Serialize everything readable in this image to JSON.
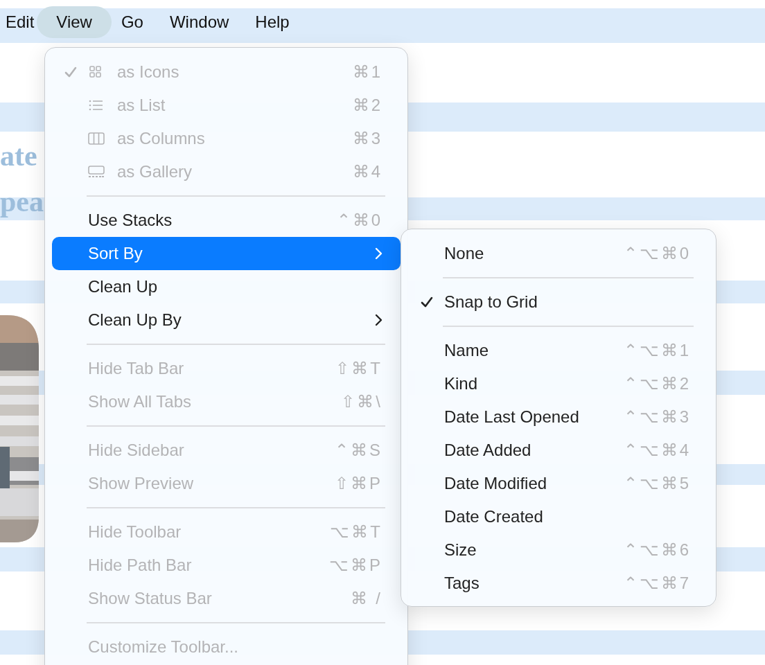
{
  "menu_bar": [
    {
      "label": "Edit",
      "selected": false
    },
    {
      "label": "View",
      "selected": true
    },
    {
      "label": "Go",
      "selected": false
    },
    {
      "label": "Window",
      "selected": false
    },
    {
      "label": "Help",
      "selected": false
    }
  ],
  "background_text": [
    "ate",
    "pea"
  ],
  "view_menu": {
    "items": [
      {
        "kind": "view",
        "label": "as Icons",
        "shortcut": "⌘1",
        "checked": true,
        "disabled": true,
        "selected": false
      },
      {
        "kind": "view",
        "label": "as List",
        "shortcut": "⌘2",
        "checked": false,
        "disabled": true,
        "selected": false
      },
      {
        "kind": "view",
        "label": "as Columns",
        "shortcut": "⌘3",
        "checked": false,
        "disabled": true,
        "selected": false
      },
      {
        "kind": "view",
        "label": "as Gallery",
        "shortcut": "⌘4",
        "checked": false,
        "disabled": true,
        "selected": false
      },
      {
        "kind": "separator"
      },
      {
        "kind": "item",
        "label": "Use Stacks",
        "shortcut": "⌃⌘0",
        "checked": false,
        "disabled": false,
        "selected": false
      },
      {
        "kind": "submenu",
        "label": "Sort By",
        "checked": false,
        "disabled": false,
        "selected": true
      },
      {
        "kind": "item",
        "label": "Clean Up",
        "checked": false,
        "disabled": false,
        "selected": false
      },
      {
        "kind": "submenu",
        "label": "Clean Up By",
        "checked": false,
        "disabled": false,
        "selected": false
      },
      {
        "kind": "separator"
      },
      {
        "kind": "item",
        "label": "Hide Tab Bar",
        "shortcut": "⇧⌘T",
        "checked": false,
        "disabled": true,
        "selected": false
      },
      {
        "kind": "item",
        "label": "Show All Tabs",
        "shortcut": "⇧⌘\\",
        "checked": false,
        "disabled": true,
        "selected": false
      },
      {
        "kind": "separator"
      },
      {
        "kind": "item",
        "label": "Hide Sidebar",
        "shortcut": "⌃⌘S",
        "checked": false,
        "disabled": true,
        "selected": false
      },
      {
        "kind": "item",
        "label": "Show Preview",
        "shortcut": "⇧⌘P",
        "checked": false,
        "disabled": true,
        "selected": false
      },
      {
        "kind": "separator"
      },
      {
        "kind": "item",
        "label": "Hide Toolbar",
        "shortcut": "⌥⌘T",
        "checked": false,
        "disabled": true,
        "selected": false
      },
      {
        "kind": "item",
        "label": "Hide Path Bar",
        "shortcut": "⌥⌘P",
        "checked": false,
        "disabled": true,
        "selected": false
      },
      {
        "kind": "item",
        "label": "Show Status Bar",
        "shortcut": "⌘ /",
        "checked": false,
        "disabled": true,
        "selected": false
      },
      {
        "kind": "separator"
      },
      {
        "kind": "item",
        "label": "Customize Toolbar...",
        "checked": false,
        "disabled": true,
        "selected": false
      }
    ]
  },
  "sort_by_menu": {
    "items": [
      {
        "kind": "item",
        "label": "None",
        "shortcut": "⌃⌥⌘0",
        "checked": false,
        "disabled": false,
        "selected": false
      },
      {
        "kind": "separator"
      },
      {
        "kind": "item",
        "label": "Snap to Grid",
        "checked": true,
        "disabled": false,
        "selected": false
      },
      {
        "kind": "separator"
      },
      {
        "kind": "item",
        "label": "Name",
        "shortcut": "⌃⌥⌘1",
        "checked": false,
        "disabled": false,
        "selected": false
      },
      {
        "kind": "item",
        "label": "Kind",
        "shortcut": "⌃⌥⌘2",
        "checked": false,
        "disabled": false,
        "selected": false
      },
      {
        "kind": "item",
        "label": "Date Last Opened",
        "shortcut": "⌃⌥⌘3",
        "checked": false,
        "disabled": false,
        "selected": false
      },
      {
        "kind": "item",
        "label": "Date Added",
        "shortcut": "⌃⌥⌘4",
        "checked": false,
        "disabled": false,
        "selected": false
      },
      {
        "kind": "item",
        "label": "Date Modified",
        "shortcut": "⌃⌥⌘5",
        "checked": false,
        "disabled": false,
        "selected": false
      },
      {
        "kind": "item",
        "label": "Date Created",
        "checked": false,
        "disabled": false,
        "selected": false
      },
      {
        "kind": "item",
        "label": "Size",
        "shortcut": "⌃⌥⌘6",
        "checked": false,
        "disabled": false,
        "selected": false
      },
      {
        "kind": "item",
        "label": "Tags",
        "shortcut": "⌃⌥⌘7",
        "checked": false,
        "disabled": false,
        "selected": false
      }
    ]
  }
}
